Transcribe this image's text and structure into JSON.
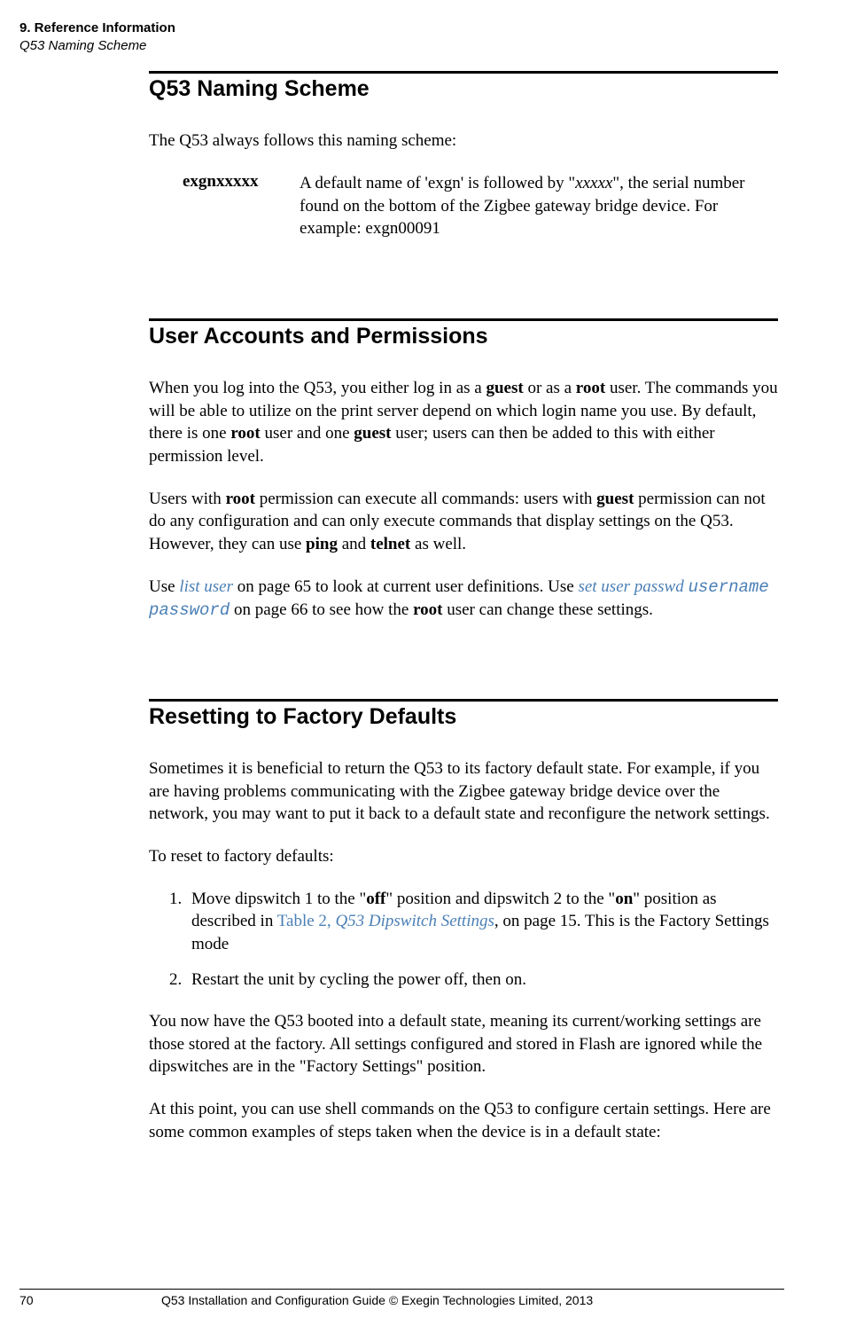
{
  "header": {
    "chapter": "9. Reference Information",
    "section": "Q53 Naming Scheme"
  },
  "s1": {
    "title": "Q53 Naming Scheme",
    "intro": "The Q53 always follows this naming scheme:",
    "term": "exgnxxxxx",
    "desc_a": "A default name of 'exgn' is followed by \"",
    "desc_i": "xxxxx",
    "desc_b": "\", the serial number found on the bottom of the Zigbee gateway bridge device. For example: exgn00091"
  },
  "s2": {
    "title": "User Accounts and Permissions",
    "p1a": "When you log into the Q53, you either log in as a ",
    "p1b": "guest",
    "p1c": " or as a ",
    "p1d": "root",
    "p1e": " user. The commands you will be able to utilize on the print server depend on which login name you use. By default, there is one ",
    "p1f": "root",
    "p1g": " user and one ",
    "p1h": "guest",
    "p1i": " user; users can then be added to this with either permission level.",
    "p2a": "Users with ",
    "p2b": "root",
    "p2c": " permission can execute all commands: users with ",
    "p2d": "guest",
    "p2e": " permission can not do any configuration and can only execute commands that display settings on the Q53. However, they can use ",
    "p2f": "ping",
    "p2g": " and ",
    "p2h": "telnet",
    "p2i": " as well.",
    "p3a": "Use ",
    "p3link1": "list user",
    "p3b": " on page 65 to look at current user definitions. Use ",
    "p3link2a": "set user passwd ",
    "p3mono": "username password",
    "p3c": " on page 66 to see how the ",
    "p3d": "root",
    "p3e": " user can change these settings."
  },
  "s3": {
    "title": "Resetting to Factory Defaults",
    "p1": "Sometimes it is beneficial to return the Q53 to its factory default state. For example, if you are having problems communicating with the Zigbee gateway bridge device over the network, you may want to put it back to a default state and reconfigure the network settings.",
    "p2": "To reset to factory defaults:",
    "li1a": "Move dipswitch 1 to the \"",
    "li1b": "off",
    "li1c": "\" position and dipswitch 2 to the \"",
    "li1d": "on",
    "li1e": "\" position as described in ",
    "li1link": "Table 2, ",
    "li1link2": "Q53 Dipswitch Settings",
    "li1f": ", on page 15. This is the Factory Settings mode",
    "li2": "Restart the unit by cycling the power off, then on.",
    "p3": "You now have the Q53 booted into a default state, meaning its current/working settings are those stored at the factory. All settings configured and stored in Flash are ignored while the dipswitches are in the \"Factory Settings\" position.",
    "p4": "At this point, you can use shell commands on the Q53 to configure certain settings. Here are some common examples of steps taken when the device is in a default state:"
  },
  "footer": {
    "page": "70",
    "text": "Q53 Installation and Configuration Guide  © Exegin Technologies Limited, 2013"
  }
}
